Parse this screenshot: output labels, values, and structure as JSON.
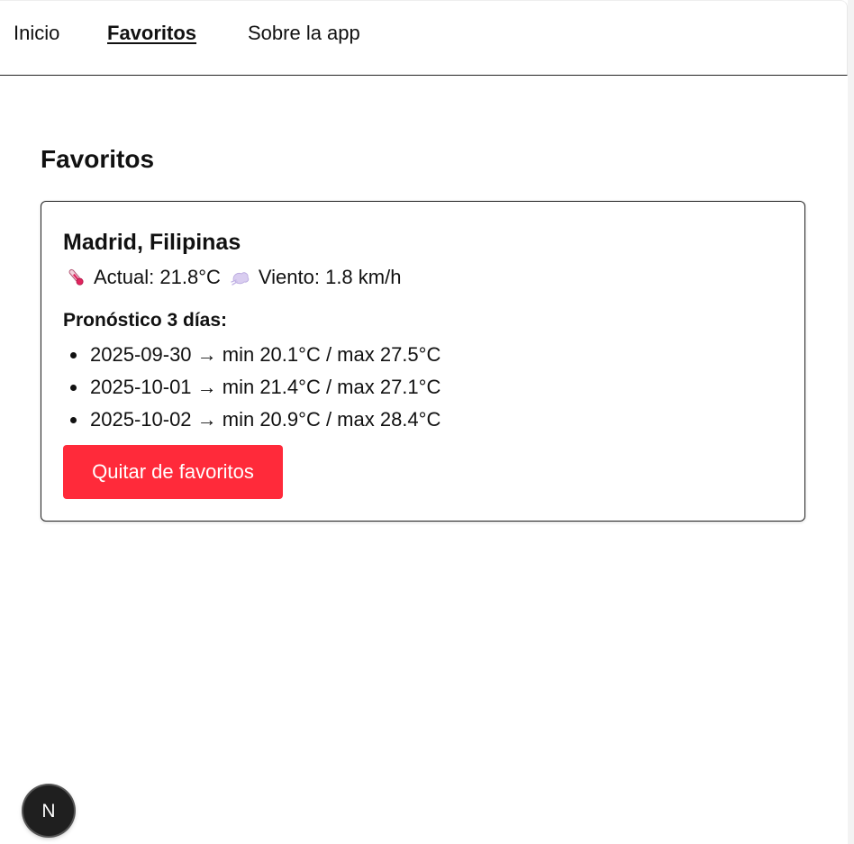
{
  "nav": {
    "links": [
      {
        "label": "Inicio",
        "active": false
      },
      {
        "label": "Favoritos",
        "active": true
      },
      {
        "label": "Sobre la app",
        "active": false
      }
    ]
  },
  "page": {
    "title": "Favoritos"
  },
  "favorites": [
    {
      "city": "Madrid, Filipinas",
      "current_label": "Actual: 21.8°C",
      "wind_label": "Viento: 1.8 km/h",
      "forecast_title": "Pronóstico 3 días:",
      "forecast": [
        "2025-09-30 → min 20.1°C / max 27.5°C",
        "2025-10-01 → min 21.4°C / max 27.1°C",
        "2025-10-02 → min 20.9°C / max 28.4°C"
      ],
      "remove_label": "Quitar de favoritos",
      "icons": {
        "temperature": "thermometer-icon",
        "wind": "wind-icon"
      }
    }
  ],
  "badge": {
    "letter": "N",
    "icon": "nextjs-logo-icon"
  },
  "colors": {
    "danger_button": "#ff2a3a",
    "text": "#111111",
    "badge_bg": "#1f1f1f"
  }
}
